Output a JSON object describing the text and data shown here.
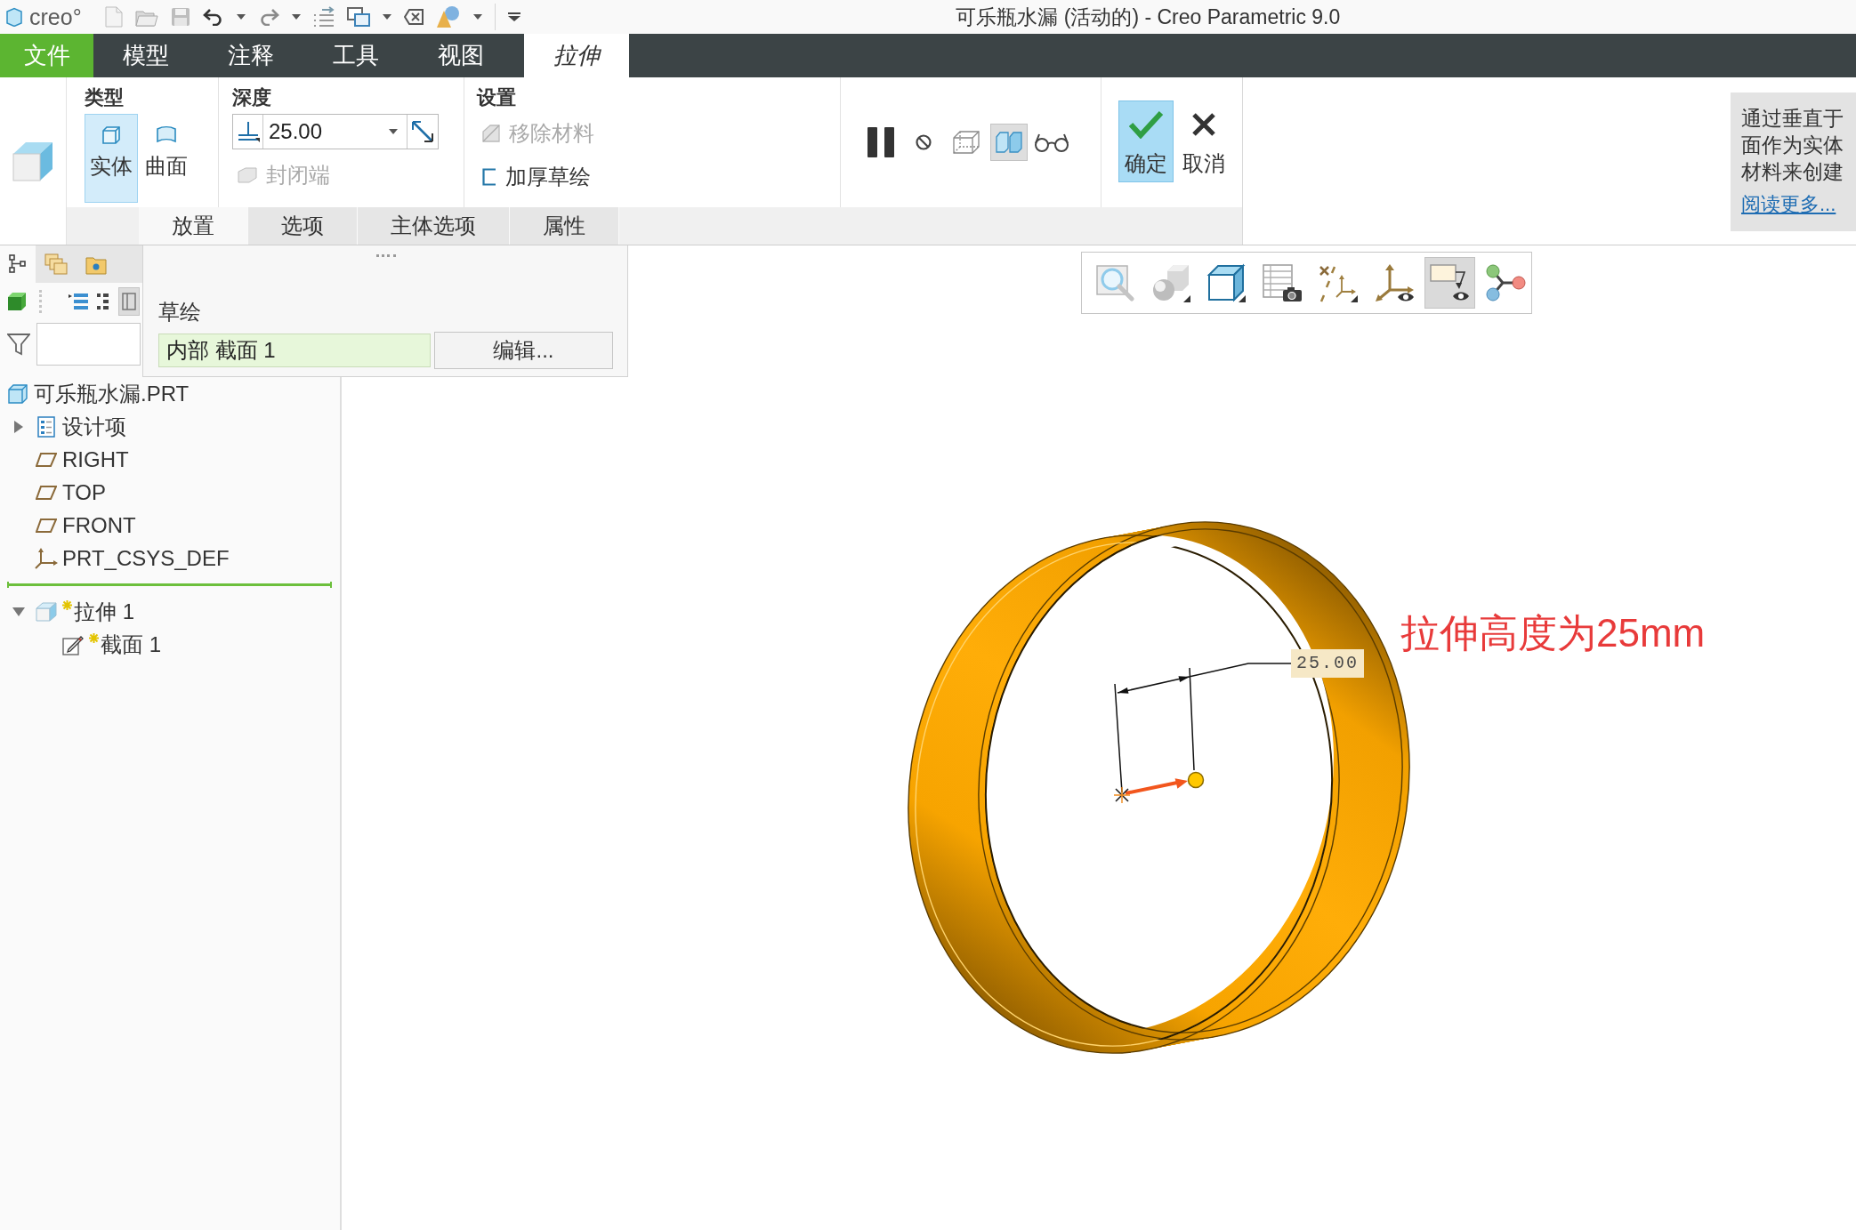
{
  "window": {
    "logo": "creo°",
    "title": "可乐瓶水漏 (活动的) - Creo Parametric 9.0"
  },
  "menu_tabs": [
    {
      "label": "文件",
      "kind": "file",
      "selected": false
    },
    {
      "label": "模型",
      "kind": "tab",
      "selected": false
    },
    {
      "label": "注释",
      "kind": "tab",
      "selected": false
    },
    {
      "label": "工具",
      "kind": "tab",
      "selected": false
    },
    {
      "label": "视图",
      "kind": "tab",
      "selected": false
    },
    {
      "label": "拉伸",
      "kind": "contextual",
      "selected": true
    }
  ],
  "ribbon": {
    "type_group": {
      "label": "类型",
      "options": [
        {
          "kind": "solid",
          "label": "实体",
          "selected": true
        },
        {
          "kind": "surface",
          "label": "曲面",
          "selected": false
        }
      ]
    },
    "depth_group": {
      "label": "深度",
      "value": "25.00",
      "capped_ends": {
        "label": "封闭端",
        "disabled": true
      }
    },
    "settings_group": {
      "label": "设置",
      "options": [
        {
          "kind": "remove",
          "label": "移除材料",
          "disabled": true
        },
        {
          "kind": "thicken",
          "label": "加厚草绘",
          "disabled": false
        }
      ]
    },
    "preview_tools": [
      {
        "kind": "pause",
        "selected": false
      },
      {
        "kind": "stop",
        "selected": false
      },
      {
        "kind": "mesh",
        "selected": false
      },
      {
        "kind": "verify",
        "selected": true
      },
      {
        "kind": "glasses",
        "selected": false
      }
    ],
    "actions": [
      {
        "kind": "confirm",
        "label": "确定",
        "highlighted": true
      },
      {
        "kind": "cancel",
        "label": "取消",
        "highlighted": false
      }
    ]
  },
  "sub_tabs": [
    {
      "label": "放置",
      "selected": true
    },
    {
      "label": "选项",
      "selected": false
    },
    {
      "label": "主体选项",
      "selected": false
    },
    {
      "label": "属性",
      "selected": false
    }
  ],
  "help_panel": {
    "lines": [
      "通过垂直于",
      "面作为实体",
      "材料来创建"
    ],
    "link": "阅读更多..."
  },
  "navigator_tabs": [
    {
      "kind": "tree",
      "selected": true
    },
    {
      "kind": "layers",
      "selected": false
    },
    {
      "kind": "folder",
      "selected": false
    }
  ],
  "model_tree": {
    "root": {
      "label": "可乐瓶水漏.PRT",
      "kind": "part",
      "new": false,
      "children": [
        {
          "label": "设计项",
          "kind": "folder",
          "new": false,
          "expanded": false
        },
        {
          "label": "RIGHT",
          "kind": "plane",
          "new": false
        },
        {
          "label": "TOP",
          "kind": "plane",
          "new": false
        },
        {
          "label": "FRONT",
          "kind": "plane",
          "new": false
        },
        {
          "label": "PRT_CSYS_DEF",
          "kind": "csys",
          "new": false
        },
        {
          "kind": "insert"
        },
        {
          "label": "拉伸 1",
          "kind": "extrude",
          "new": true,
          "expanded": true,
          "children": [
            {
              "label": "截面 1",
              "kind": "sketch",
              "new": true
            }
          ]
        }
      ]
    }
  },
  "placement_panel": {
    "label": "草绘",
    "sketch": "内部 截面 1",
    "button": "编辑..."
  },
  "view_toolbar": [
    {
      "kind": "refit",
      "selected": false
    },
    {
      "kind": "shading",
      "selected": false
    },
    {
      "kind": "views",
      "selected": false
    },
    {
      "kind": "manager",
      "selected": false
    },
    {
      "kind": "datums",
      "selected": false
    },
    {
      "kind": "axes",
      "selected": false
    },
    {
      "kind": "annotations",
      "selected": true
    },
    {
      "kind": "network",
      "selected": false
    }
  ],
  "viewport": {
    "dimension": "25.00",
    "annotation": "拉伸高度为25mm"
  }
}
